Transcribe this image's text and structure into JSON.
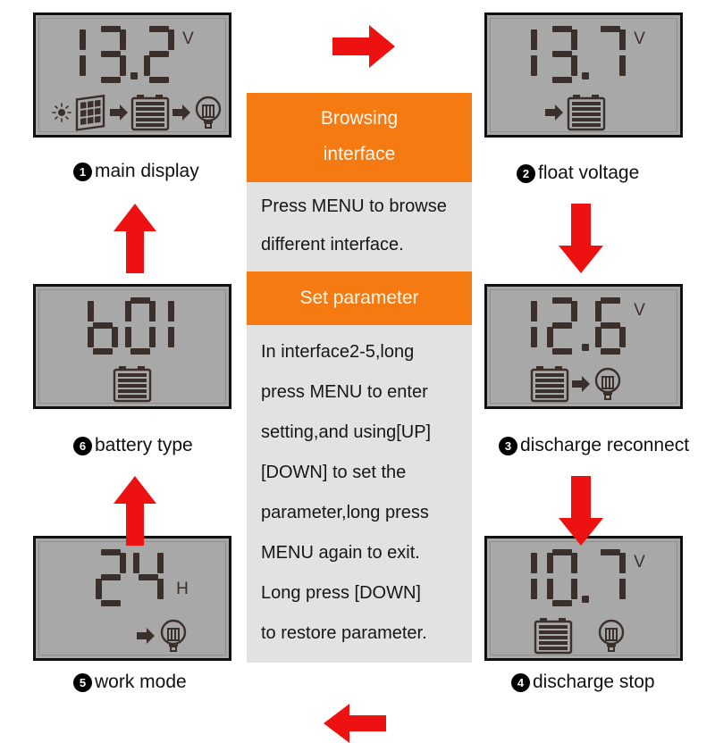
{
  "panels": [
    {
      "id": "main-display",
      "number": "❶",
      "number_plain": "1",
      "label": "main display",
      "reading": "13.2",
      "unit": "V",
      "icons": [
        "sun-icon",
        "solar-panel-icon",
        "arrow-right-icon",
        "battery-icon",
        "arrow-right-icon",
        "light-bulb-icon"
      ]
    },
    {
      "id": "float-voltage",
      "number": "❷",
      "number_plain": "2",
      "label": "float voltage",
      "reading": "13.7",
      "unit": "V",
      "icons": [
        "arrow-right-icon",
        "battery-icon"
      ]
    },
    {
      "id": "discharge-reconnect",
      "number": "❸",
      "number_plain": "3",
      "label": "discharge reconnect",
      "reading": "12.6",
      "unit": "V",
      "icons": [
        "battery-icon",
        "arrow-right-icon",
        "light-bulb-icon"
      ]
    },
    {
      "id": "discharge-stop",
      "number": "❹",
      "number_plain": "4",
      "label": "discharge stop",
      "reading": "10.7",
      "unit": "V",
      "icons": [
        "battery-icon",
        "light-bulb-icon"
      ]
    },
    {
      "id": "work-mode",
      "number": "❺",
      "number_plain": "5",
      "label": "work mode",
      "reading": "24",
      "unit": "H",
      "icons": [
        "arrow-right-icon",
        "light-bulb-icon"
      ]
    },
    {
      "id": "battery-type",
      "number": "❻",
      "number_plain": "6",
      "label": "battery type",
      "reading": "b01",
      "unit": "",
      "icons": [
        "battery-icon"
      ]
    }
  ],
  "center": {
    "browsing_title_line1": "Browsing",
    "browsing_title_line2": "interface",
    "browsing_note_line1": "Press  MENU  to  browse",
    "browsing_note_line2": "different    interface.",
    "set_title": "Set parameter",
    "set_note_line1": "In interface2-5,long",
    "set_note_line2": "press MENU to enter",
    "set_note_line3": "setting,and using[UP]",
    "set_note_line4": "[DOWN] to set the",
    "set_note_line5": "parameter,long press",
    "set_note_line6": "MENU again to exit.",
    "set_note_line7": "Long press [DOWN]",
    "set_note_line8": "to restore parameter."
  },
  "flow_arrows": [
    {
      "name": "arrow-top-right",
      "direction": "right"
    },
    {
      "name": "arrow-right-upper",
      "direction": "down"
    },
    {
      "name": "arrow-right-lower",
      "direction": "down"
    },
    {
      "name": "arrow-bottom-left",
      "direction": "left"
    },
    {
      "name": "arrow-left-lower",
      "direction": "up"
    },
    {
      "name": "arrow-left-upper",
      "direction": "up"
    }
  ],
  "colors": {
    "accent_orange": "#f47a11",
    "arrow_red": "#ee1111",
    "lcd_background": "#a8a8a8",
    "lcd_segment": "#3a2f2a",
    "note_background": "#e2e2e2"
  }
}
